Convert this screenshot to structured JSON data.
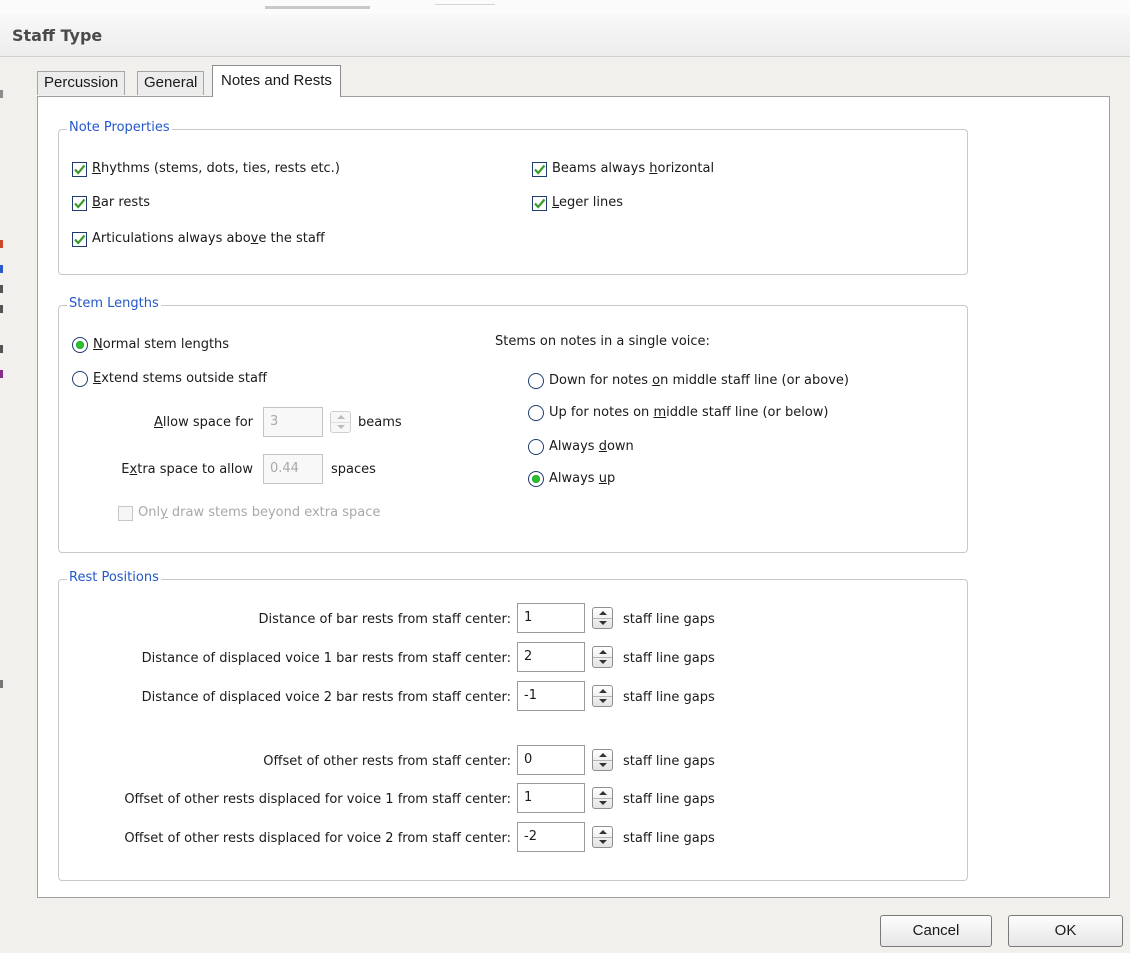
{
  "window": {
    "title": "Staff Type"
  },
  "tabs": [
    {
      "label": "Percussion",
      "active": false
    },
    {
      "label": "General",
      "active": false
    },
    {
      "label": "Notes and Rests",
      "active": true
    }
  ],
  "note_properties": {
    "group_label": "Note Properties",
    "rhythms": {
      "mnemonic": "R",
      "rest": "hythms (stems, dots, ties, rests etc.)",
      "checked": true
    },
    "bar_rests": {
      "mnemonic": "B",
      "rest": "ar rests",
      "checked": true
    },
    "articulations": {
      "pre": "Articulations always abo",
      "mnemonic": "v",
      "post": "e the staff",
      "checked": true
    },
    "beams_horizontal": {
      "pre": "Beams always ",
      "mnemonic": "h",
      "post": "orizontal",
      "checked": true
    },
    "leger_lines": {
      "mnemonic": "L",
      "rest": "eger lines",
      "checked": true
    }
  },
  "stem_lengths": {
    "group_label": "Stem Lengths",
    "normal": {
      "mnemonic": "N",
      "rest": "ormal stem lengths",
      "selected": true
    },
    "extend": {
      "mnemonic": "E",
      "rest": "xtend stems outside staff",
      "selected": false
    },
    "allow_space": {
      "mnemonic": "A",
      "rest": "llow space for",
      "value": "3",
      "unit": "beams"
    },
    "extra_space": {
      "pre": "E",
      "mnemonic": "x",
      "post": "tra space to allow",
      "value": "0.44",
      "unit": "spaces"
    },
    "only_draw": {
      "pre": "Onl",
      "mnemonic": "y",
      "post": " draw stems beyond extra space",
      "checked": false
    },
    "single_voice_heading": "Stems on notes in a single voice:",
    "down_middle": {
      "pre": "Down for notes ",
      "mnemonic": "o",
      "post": "n middle staff line (or above)",
      "selected": false
    },
    "up_middle": {
      "pre": "Up for notes on ",
      "mnemonic": "m",
      "post": "iddle staff line (or below)",
      "selected": false
    },
    "always_down": {
      "pre": "Always ",
      "mnemonic": "d",
      "post": "own",
      "selected": false
    },
    "always_up": {
      "pre": "Always ",
      "mnemonic": "u",
      "post": "p",
      "selected": true
    }
  },
  "rest_positions": {
    "group_label": "Rest Positions",
    "unit": "staff line gaps",
    "rows": [
      {
        "label": "Distance of bar rests from staff center:",
        "value": "1"
      },
      {
        "label": "Distance of displaced voice 1 bar rests from staff center:",
        "value": "2"
      },
      {
        "label": "Distance of displaced voice 2 bar rests from staff center:",
        "value": "-1"
      },
      {
        "label": "Offset of other rests from staff center:",
        "value": "0"
      },
      {
        "label": "Offset of other rests displaced for voice 1 from staff center:",
        "value": "1"
      },
      {
        "label": "Offset of other rests displaced for voice 2 from staff center:",
        "value": "-2"
      }
    ]
  },
  "buttons": {
    "cancel": "Cancel",
    "ok": "OK"
  },
  "colors": {
    "group_label": "#2457c8",
    "radio_dot": "#2bc430",
    "check_mark": "#3a9b2a"
  }
}
